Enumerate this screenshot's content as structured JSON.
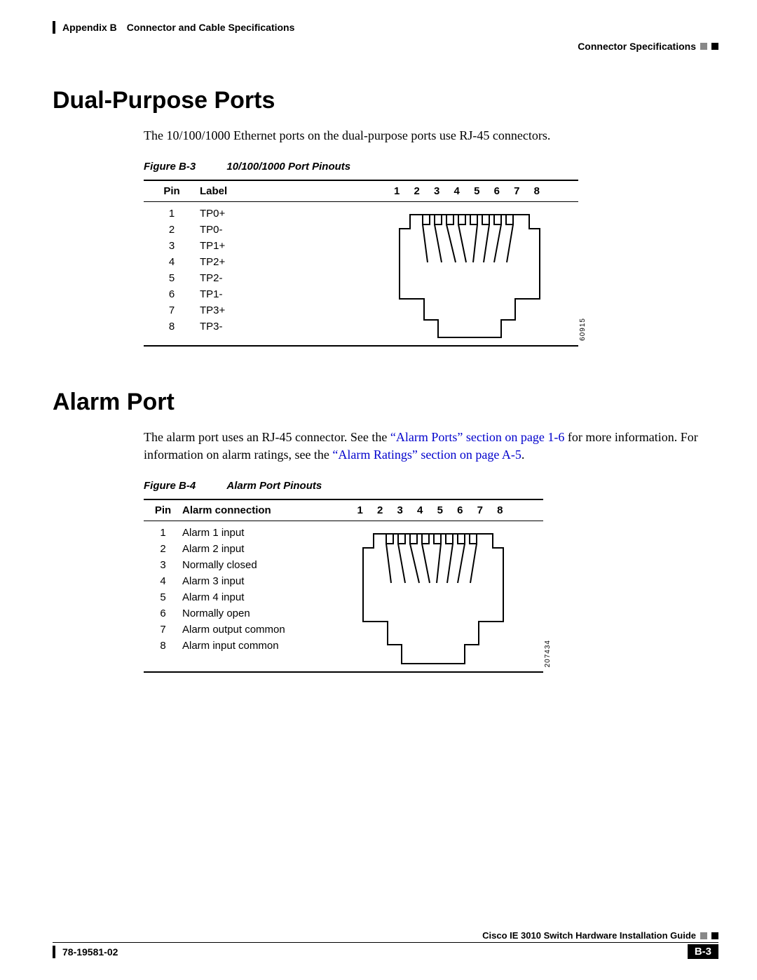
{
  "header": {
    "appendix": "Appendix B",
    "appendix_title": "Connector and Cable Specifications",
    "section_header": "Connector Specifications"
  },
  "section1": {
    "title": "Dual-Purpose Ports",
    "body": "The 10/100/1000 Ethernet ports on the dual-purpose ports use RJ-45 connectors.",
    "figure_num": "Figure B-3",
    "figure_title": "10/100/1000 Port Pinouts",
    "col_pin": "Pin",
    "col_label": "Label",
    "diagram_nums": "1 2 3 4 5 6 7 8",
    "side_id": "60915",
    "rows": [
      {
        "pin": "1",
        "label": "TP0+"
      },
      {
        "pin": "2",
        "label": "TP0-"
      },
      {
        "pin": "3",
        "label": "TP1+"
      },
      {
        "pin": "4",
        "label": "TP2+"
      },
      {
        "pin": "5",
        "label": "TP2-"
      },
      {
        "pin": "6",
        "label": "TP1-"
      },
      {
        "pin": "7",
        "label": "TP3+"
      },
      {
        "pin": "8",
        "label": "TP3-"
      }
    ]
  },
  "section2": {
    "title": "Alarm Port",
    "body_pre": "The alarm port uses an RJ-45 connector. See the ",
    "xref1": "“Alarm Ports” section on page 1-6",
    "body_mid": " for more information. For information on alarm ratings, see the ",
    "xref2": "“Alarm Ratings” section on page A-5",
    "body_end": ".",
    "figure_num": "Figure B-4",
    "figure_title": "Alarm Port Pinouts",
    "col_pin": "Pin",
    "col_label": "Alarm connection",
    "diagram_nums": "1 2 3 4 5 6 7 8",
    "side_id": "207434",
    "rows": [
      {
        "pin": "1",
        "label": "Alarm 1 input"
      },
      {
        "pin": "2",
        "label": "Alarm 2 input"
      },
      {
        "pin": "3",
        "label": "Normally closed"
      },
      {
        "pin": "4",
        "label": "Alarm 3 input"
      },
      {
        "pin": "5",
        "label": "Alarm 4 input"
      },
      {
        "pin": "6",
        "label": "Normally open"
      },
      {
        "pin": "7",
        "label": "Alarm output common"
      },
      {
        "pin": "8",
        "label": "Alarm input common"
      }
    ]
  },
  "footer": {
    "guide_title": "Cisco IE 3010 Switch Hardware Installation Guide",
    "doc_num": "78-19581-02",
    "page_num": "B-3"
  }
}
